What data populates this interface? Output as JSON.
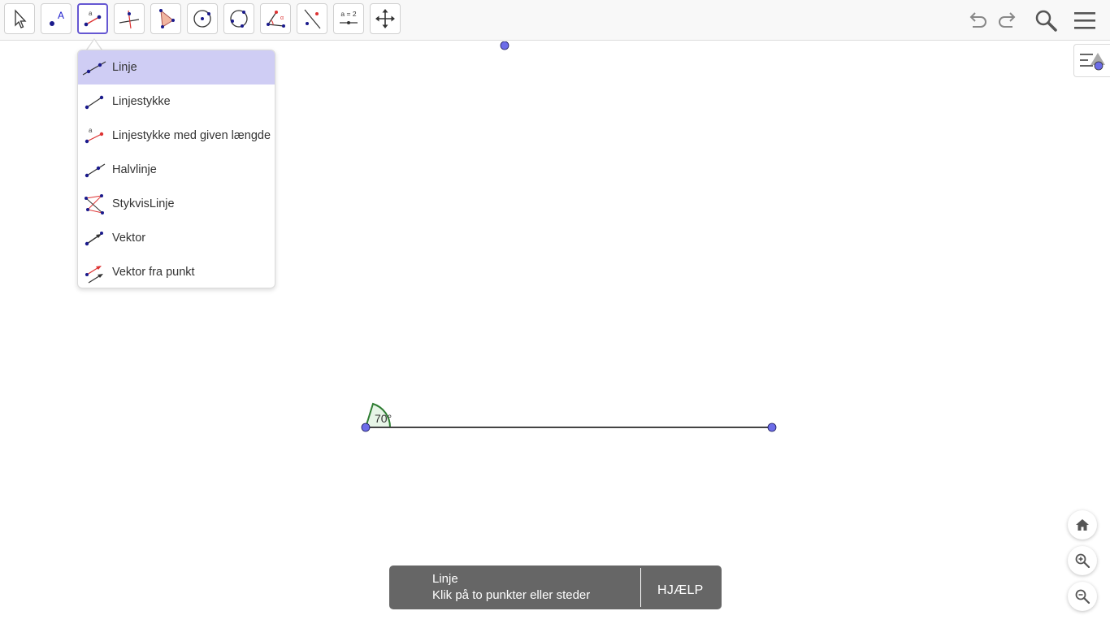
{
  "toolbar": {
    "tools": [
      {
        "name": "move-tool",
        "icon": "arrow-pointer-icon"
      },
      {
        "name": "point-tool",
        "icon": "point-icon"
      },
      {
        "name": "segment-length-tool",
        "icon": "segment-length-icon",
        "active": true
      },
      {
        "name": "perpendicular-tool",
        "icon": "perpendicular-icon"
      },
      {
        "name": "polygon-tool",
        "icon": "polygon-icon"
      },
      {
        "name": "circle-tool",
        "icon": "circle-center-icon"
      },
      {
        "name": "circle-3pts-tool",
        "icon": "circle-three-points-icon"
      },
      {
        "name": "angle-tool",
        "icon": "angle-icon"
      },
      {
        "name": "reflect-tool",
        "icon": "reflect-line-icon"
      },
      {
        "name": "slider-tool",
        "icon": "slider-icon",
        "label": "a = 2"
      },
      {
        "name": "move-graphics-tool",
        "icon": "move-graphics-icon"
      }
    ],
    "right": [
      "undo-icon",
      "redo-icon",
      "search-icon",
      "menu-icon"
    ]
  },
  "dropdown": {
    "items": [
      {
        "label": "Linje",
        "icon": "line-icon",
        "selected": true
      },
      {
        "label": "Linjestykke",
        "icon": "segment-icon"
      },
      {
        "label": "Linjestykke med given længde",
        "icon": "segment-fixed-length-icon",
        "badge": "a"
      },
      {
        "label": "Halvlinje",
        "icon": "ray-icon"
      },
      {
        "label": "StykvisLinje",
        "icon": "polyline-icon"
      },
      {
        "label": "Vektor",
        "icon": "vector-icon"
      },
      {
        "label": "Vektor fra punkt",
        "icon": "vector-from-point-icon"
      }
    ]
  },
  "canvas": {
    "angle_label": "70°"
  },
  "help": {
    "title": "Linje",
    "text": "Klik på to punkter eller steder",
    "button": "HJÆLP"
  },
  "colors": {
    "accent": "#6557d2",
    "point": "#6c6ce8",
    "angle": "#2e7d32",
    "selected_bg": "#cfcdf4",
    "help_bg": "#666666"
  }
}
